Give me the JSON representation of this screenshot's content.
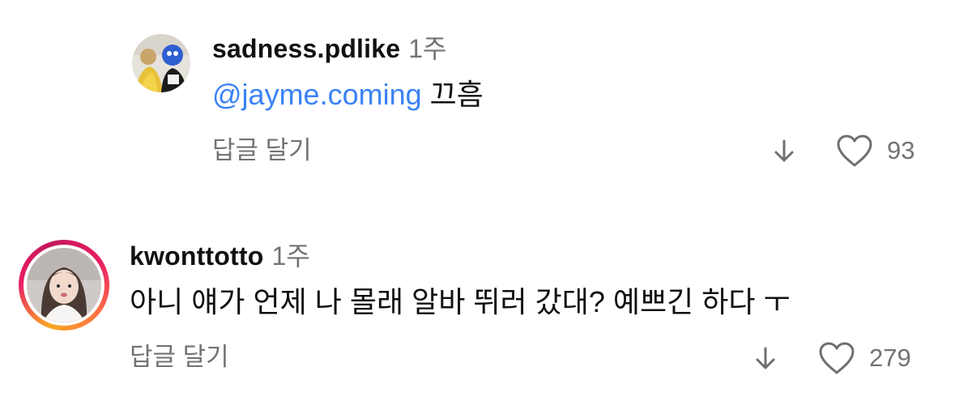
{
  "comments": [
    {
      "username": "sadness.pdlike",
      "time": "1주",
      "mention": "@jayme.coming",
      "text": "끄흠",
      "reply_label": "답글 달기",
      "like_count": "93",
      "icons": {
        "translate": "down-arrow-icon",
        "like": "heart-outline-icon"
      }
    },
    {
      "username": "kwonttotto",
      "time": "1주",
      "text": "아니 얘가 언제 나 몰래 알바 뛰러 갔대? 예쁘긴 하다 ㅜ",
      "reply_label": "답글 달기",
      "like_count": "279",
      "has_story_ring": true,
      "icons": {
        "translate": "down-arrow-icon",
        "like": "heart-outline-icon"
      }
    }
  ],
  "colors": {
    "mention": "#3b82f6",
    "secondary_text": "#737373",
    "primary_text": "#111111"
  }
}
